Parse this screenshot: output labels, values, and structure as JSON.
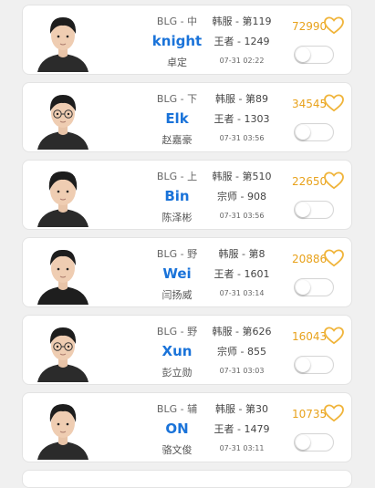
{
  "colors": {
    "accent": "#1a73d9",
    "score": "#e8a21c",
    "heart": "#f0b43a"
  },
  "players": [
    {
      "team_pos": "BLG - 中",
      "nick": "knight",
      "real_name": "卓定",
      "server_rank": "韩服 - 第119",
      "tier": "王者 - 1249",
      "time": "07-31 02:22",
      "score": "72990",
      "favorite_icon": "heart-outline-icon"
    },
    {
      "team_pos": "BLG - 下",
      "nick": "Elk",
      "real_name": "赵嘉豪",
      "server_rank": "韩服 - 第89",
      "tier": "王者 - 1303",
      "time": "07-31 03:56",
      "score": "34545",
      "favorite_icon": "heart-outline-icon"
    },
    {
      "team_pos": "BLG - 上",
      "nick": "Bin",
      "real_name": "陈泽彬",
      "server_rank": "韩服 - 第510",
      "tier": "宗师 - 908",
      "time": "07-31 03:56",
      "score": "22650",
      "favorite_icon": "heart-outline-icon"
    },
    {
      "team_pos": "BLG - 野",
      "nick": "Wei",
      "real_name": "闫扬威",
      "server_rank": "韩服 - 第8",
      "tier": "王者 - 1601",
      "time": "07-31 03:14",
      "score": "20886",
      "favorite_icon": "heart-outline-icon"
    },
    {
      "team_pos": "BLG - 野",
      "nick": "Xun",
      "real_name": "彭立勋",
      "server_rank": "韩服 - 第626",
      "tier": "宗师 - 855",
      "time": "07-31 03:03",
      "score": "16043",
      "favorite_icon": "heart-outline-icon"
    },
    {
      "team_pos": "BLG - 辅",
      "nick": "ON",
      "real_name": "骆文俊",
      "server_rank": "韩服 - 第30",
      "tier": "王者 - 1479",
      "time": "07-31 03:11",
      "score": "10735",
      "favorite_icon": "heart-outline-icon"
    }
  ]
}
